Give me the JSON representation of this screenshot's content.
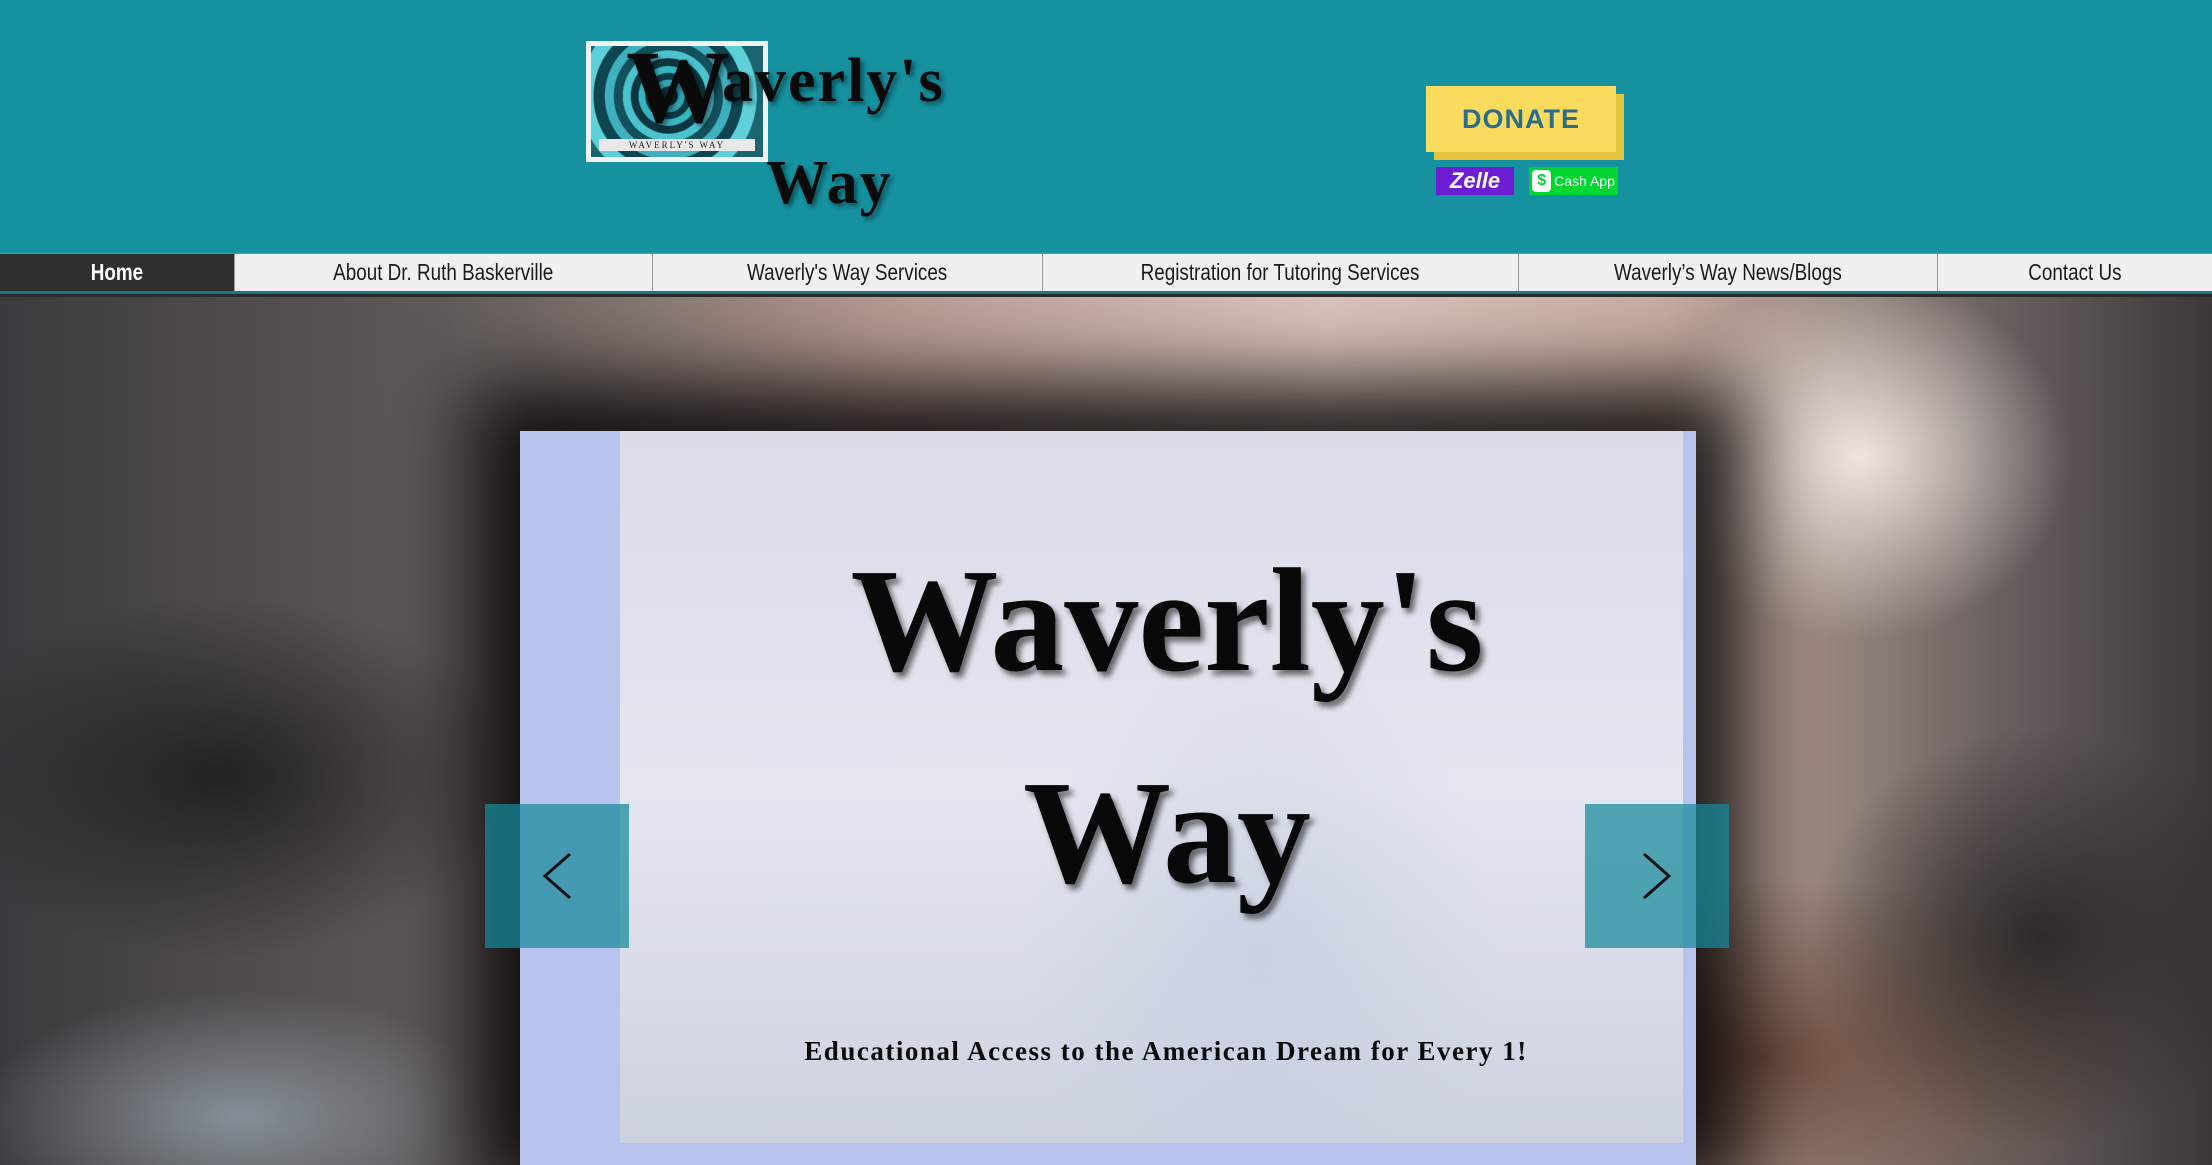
{
  "header": {
    "logo_initial": "W",
    "logo_line1": "averly's",
    "logo_line2": "Way",
    "logo_caption": "WAVERLY'S WAY",
    "donate_label": "DONATE",
    "zelle_label": "Zelle",
    "cashapp_symbol": "$",
    "cashapp_label": "Cash App"
  },
  "nav": {
    "items": [
      {
        "label": "Home",
        "active": true
      },
      {
        "label": "About Dr. Ruth Baskerville",
        "active": false
      },
      {
        "label": "Waverly's Way Services",
        "active": false
      },
      {
        "label": "Registration for Tutoring Services",
        "active": false
      },
      {
        "label": "Waverly’s Way News/Blogs",
        "active": false
      },
      {
        "label": "Contact Us",
        "active": false
      }
    ]
  },
  "hero": {
    "title_line1": "Waverly's",
    "title_line2": "Way",
    "tagline": "Educational Access to the American Dream for Every 1!"
  },
  "colors": {
    "header_bg": "#1591a0",
    "donate_bg": "#fbdb5e",
    "donate_text": "#2c6d8a",
    "nav_active_bg": "#2f2f2f",
    "zelle": "#6d1ed4",
    "cashapp": "#00d632",
    "arrow_bg": "#15899b"
  },
  "icons": {
    "prev": "chevron-left-icon",
    "next": "chevron-right-icon"
  }
}
